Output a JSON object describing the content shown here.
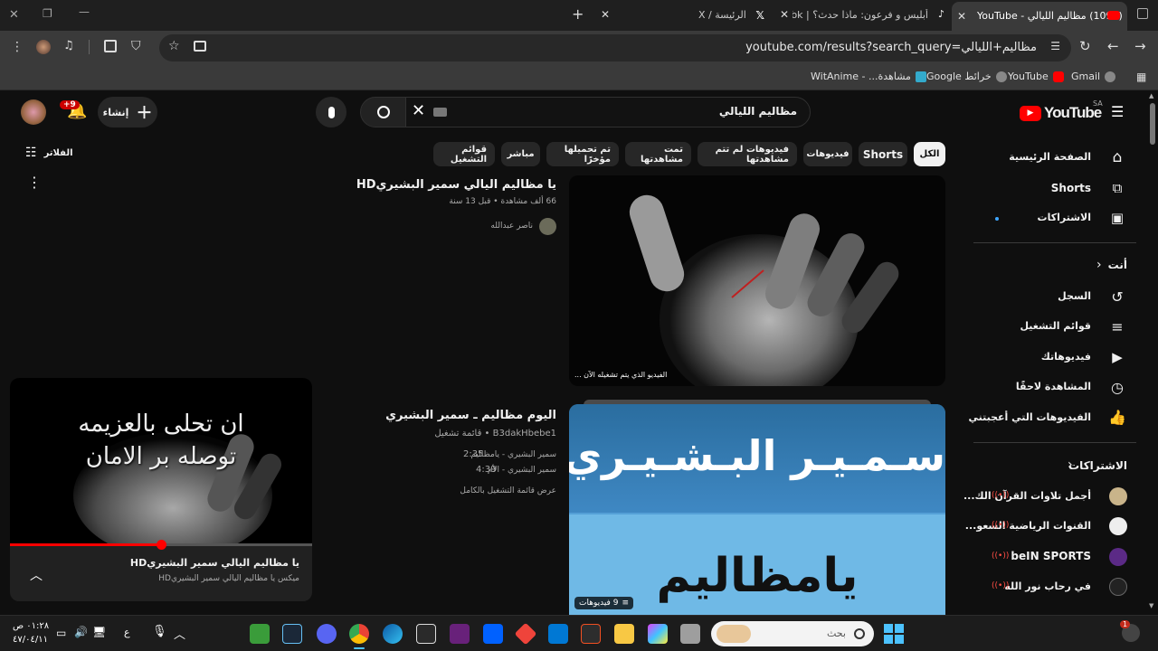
{
  "browser": {
    "tabs": [
      {
        "title": "(1098) مظاليم الليالي - YouTube",
        "active": true
      },
      {
        "title": "أبليس و فرعون: ماذا حدث؟ | TikTok",
        "active": false
      },
      {
        "title": "الرئيسة / X",
        "active": false
      }
    ],
    "new_tab_glyph": "+",
    "url": "youtube.com/results?search_query=مظاليم+الليالي",
    "bookmarks": [
      "Gmail",
      "YouTube",
      "خرائط Google",
      "مشاهدة... - WitAnime"
    ]
  },
  "youtube": {
    "logo_text": "YouTube",
    "region": "SA",
    "search_query": "مظاليم الليالي",
    "create_label": "إنشاء",
    "notifications_badge": "+9",
    "filters_label": "الفلاتر",
    "chips": [
      "الكل",
      "Shorts",
      "فيديوهات",
      "فيديوهات لم تتم مشاهدتها",
      "تمت مشاهدتها",
      "تم تحميلها مؤخرًا",
      "مباشر",
      "قوائم التشغيل"
    ],
    "sidebar": {
      "main": [
        "الصفحة الرئيسية",
        "Shorts",
        "الاشتراكات"
      ],
      "you_header": "أنت",
      "you_items": [
        "السجل",
        "قوائم التشغيل",
        "فيديوهاتك",
        "المشاهدة لاحقًا",
        "الفيديوهات التي أعجبتني"
      ],
      "subs_header": "الاشتراكات",
      "subs": [
        "أجمل تلاوات القرآن الك...",
        "القنوات الرياضية السعو...",
        "beIN SPORTS",
        "في رحاب نور الله"
      ]
    },
    "results": [
      {
        "title": "يا مظاليم اليالي سمير البشيريHD",
        "meta": "66 ألف مشاهدة • قبل 13 سنة",
        "channel": "ناصر عبدالله",
        "overlay": "الفيديو الذي يتم تشغيله الآن ..."
      },
      {
        "title": "اليوم مظاليم ـ سمير البشيري",
        "meta": "B3dakHbebe1 • قائمة تشغيل",
        "tracks": [
          {
            "name": "سمير البشيري - يامظاليم",
            "duration": "2:35"
          },
          {
            "name": "سمير البشيري - الأم",
            "duration": "4:39"
          }
        ],
        "view_full": "عرض قائمة التشغيل بالكامل",
        "thumb_top": "سـمـيـر البـشـيـري",
        "thumb_bottom": "يامظاليم",
        "video_count": "9 فيديوهات"
      }
    ],
    "miniplayer": {
      "overlay_line1": "ان تحلى بالعزيمه",
      "overlay_line2": "توصله بر الامان",
      "title": "يا مظاليم اليالي سمير البشيريHD",
      "subtitle": "ميكس يا مظاليم اليالي سمير البشيريHD",
      "progress": 0.5
    }
  },
  "taskbar": {
    "search_placeholder": "بحث",
    "time": "٠١:٢٨ ص",
    "date": "٤٧/٠٤/١١",
    "lang": "ع",
    "badge": "1"
  },
  "colors": {
    "youtube_red": "#ff0000",
    "background": "#0f0f0f",
    "accent_blue": "#3ea6ff"
  }
}
